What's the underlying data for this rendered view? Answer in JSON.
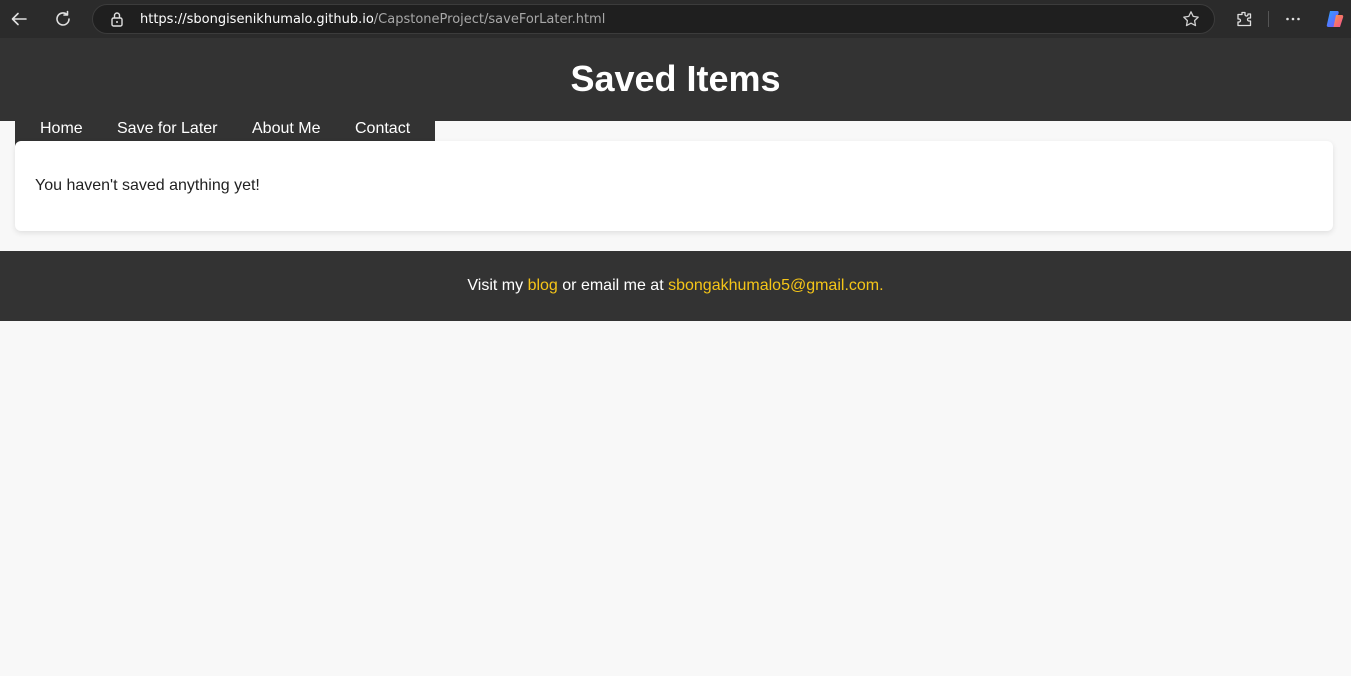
{
  "browser": {
    "url_host": "https://sbongisenikhumalo.github.io",
    "url_path": "/CapstoneProject/saveForLater.html",
    "icons": [
      "back-arrow-icon",
      "reload-icon",
      "lock-icon",
      "star-icon",
      "extensions-icon",
      "more-icon",
      "copilot-icon"
    ]
  },
  "header": {
    "title": "Saved Items"
  },
  "nav": {
    "items": [
      {
        "label": "Home"
      },
      {
        "label": "Save for Later"
      },
      {
        "label": "About Me"
      },
      {
        "label": "Contact"
      }
    ]
  },
  "main": {
    "empty_message": "You haven't saved anything yet!"
  },
  "footer": {
    "prefix": "Visit my ",
    "blog_link": "blog",
    "middle": " or email me at ",
    "email_link": "sbongakhumalo5@gmail.com",
    "suffix": "."
  },
  "colors": {
    "header_bg": "#333333",
    "page_bg": "#f8f8f8",
    "link": "#f5c518",
    "browser_bg": "#2b2b2b"
  }
}
